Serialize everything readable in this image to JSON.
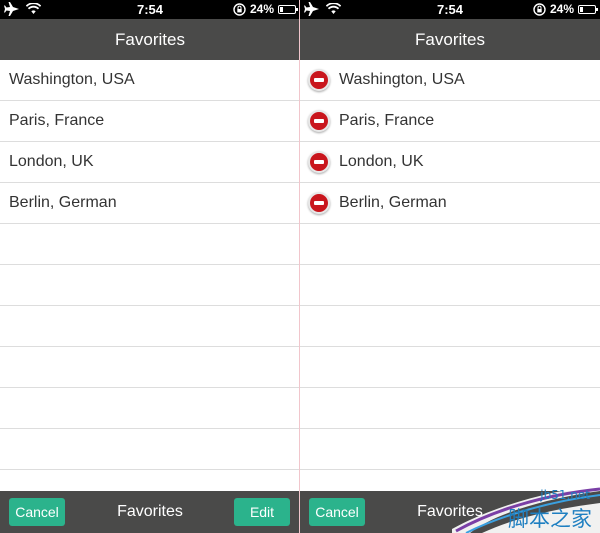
{
  "status_bar": {
    "time": "7:54",
    "battery_percent": "24%",
    "battery_level": 0.24
  },
  "left_screen": {
    "title": "Favorites",
    "items": [
      "Washington, USA",
      "Paris, France",
      "London, UK",
      "Berlin, German"
    ],
    "toolbar": {
      "cancel_label": "Cancel",
      "title": "Favorites",
      "edit_label": "Edit"
    }
  },
  "right_screen": {
    "title": "Favorites",
    "items": [
      "Washington, USA",
      "Paris, France",
      "London, UK",
      "Berlin, German"
    ],
    "toolbar": {
      "cancel_label": "Cancel",
      "title": "Favorites"
    }
  },
  "watermark": {
    "site": "jb51.net",
    "text": "脚本之家"
  },
  "colors": {
    "navbar": "#4a4a49",
    "accent": "#2bb38c",
    "delete": "#c9161d",
    "divider": "#f1c6cc"
  },
  "icons": [
    "airplane-icon",
    "wifi-icon",
    "rotation-lock-icon",
    "battery-icon",
    "delete-icon"
  ]
}
